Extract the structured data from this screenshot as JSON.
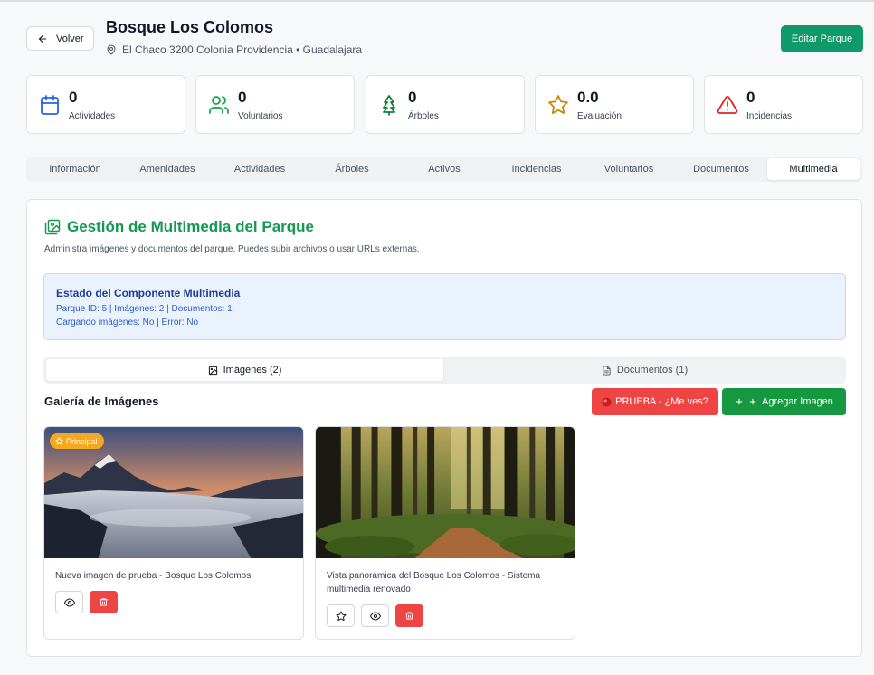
{
  "header": {
    "back_label": "Volver",
    "park_name": "Bosque Los Colomos",
    "address": "El Chaco 3200 Colonia Providencia • Guadalajara",
    "edit_label": "Editar Parque"
  },
  "stats": [
    {
      "value": "0",
      "label": "Actividades",
      "icon": "calendar-icon",
      "color": "#2563eb"
    },
    {
      "value": "0",
      "label": "Voluntarios",
      "icon": "users-icon",
      "color": "#16a34a"
    },
    {
      "value": "0",
      "label": "Árboles",
      "icon": "tree-icon",
      "color": "#15803d"
    },
    {
      "value": "0.0",
      "label": "Evaluación",
      "icon": "star-icon",
      "color": "#ca8a04"
    },
    {
      "value": "0",
      "label": "Incidencias",
      "icon": "alert-triangle-icon",
      "color": "#dc2626"
    }
  ],
  "tabs": [
    "Información",
    "Amenidades",
    "Actividades",
    "Árboles",
    "Activos",
    "Incidencias",
    "Voluntarios",
    "Documentos",
    "Multimedia"
  ],
  "active_tab": "Multimedia",
  "multimedia": {
    "title": "Gestión de Multimedia del Parque",
    "description": "Administra imágenes y documentos del parque. Puedes subir archivos o usar URLs externas.",
    "status": {
      "title": "Estado del Componente Multimedia",
      "line1": "Parque ID: 5 | Imágenes: 2 | Documentos: 1",
      "line2": "Cargando imágenes: No | Error: No"
    },
    "subtabs": {
      "images": "Imágenes (2)",
      "documents": "Documentos (1)"
    },
    "gallery_title": "Galería de Imágenes",
    "test_button": "PRUEBA - ¿Me ves?",
    "add_button": "Agregar Imagen",
    "images": [
      {
        "caption": "Nueva imagen de prueba - Bosque Los Colomos",
        "badge": "Principal",
        "is_main": true
      },
      {
        "caption": "Vista panorámica del Bosque Los Colomos - Sistema multimedia renovado",
        "is_main": false
      }
    ]
  },
  "colors": {
    "brand_green": "#0f9a6a",
    "title_green": "#15984f",
    "danger": "#ef4444",
    "info_bg": "#eaf2fe"
  }
}
